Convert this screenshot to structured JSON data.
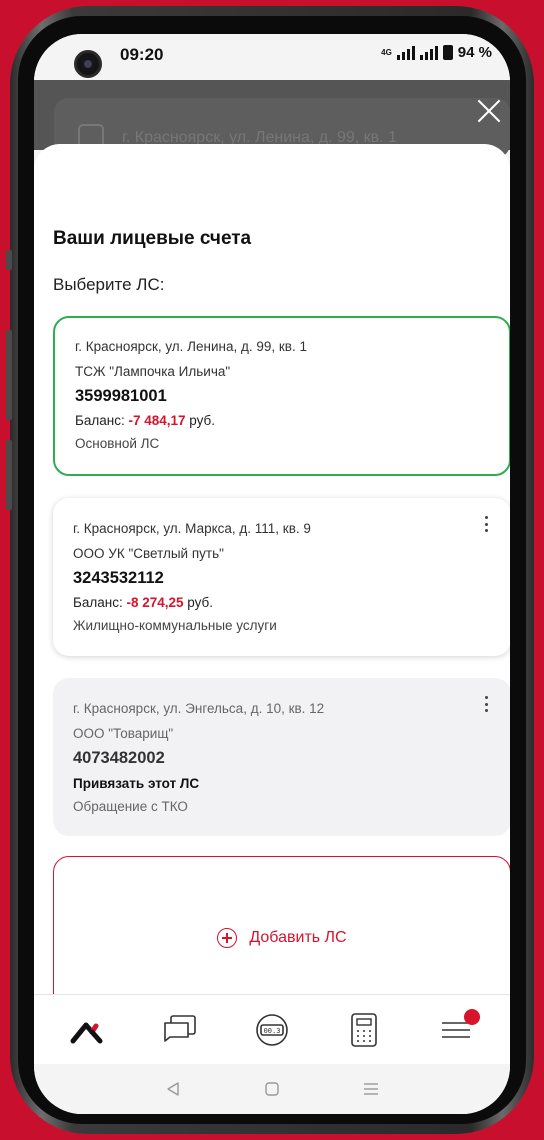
{
  "statusbar": {
    "time": "09:20",
    "network": "4G",
    "battery": "94 %"
  },
  "background": {
    "card_text": "г. Красноярск, ул. Ленина, д. 99, кв. 1"
  },
  "sheet": {
    "title": "Ваши лицевые счета",
    "subtitle": "Выберите ЛС:",
    "accounts": [
      {
        "address": "г. Красноярск, ул. Ленина, д. 99, кв. 1",
        "org": "ТСЖ \"Лампочка Ильича\"",
        "number": "3599981001",
        "balance_label": "Баланс: ",
        "balance_value": "-7 484,17",
        "balance_unit": " руб.",
        "service": "Основной ЛС",
        "selected": true
      },
      {
        "address": "г. Красноярск, ул. Маркса, д. 111, кв. 9",
        "org": "ООО УК \"Светлый путь\"",
        "number": "3243532112",
        "balance_label": "Баланс: ",
        "balance_value": "-8 274,25",
        "balance_unit": " руб.",
        "service": "Жилищно-коммунальные услуги"
      },
      {
        "address": "г. Красноярск, ул. Энгельса, д. 10, кв. 12",
        "org": "ООО \"Товарищ\"",
        "number": "4073482002",
        "bind_label": "Привязать этот ЛС",
        "service": "Обращение с ТКО"
      }
    ],
    "add_label": "Добавить ЛС"
  },
  "bottom_nav": [
    {
      "icon": "home-logo-icon"
    },
    {
      "icon": "chat-icon"
    },
    {
      "icon": "meter-icon"
    },
    {
      "icon": "calculator-icon"
    },
    {
      "icon": "menu-icon",
      "badge": true
    }
  ],
  "colors": {
    "accent": "#d8132c",
    "selected_border": "#2fae4f"
  }
}
